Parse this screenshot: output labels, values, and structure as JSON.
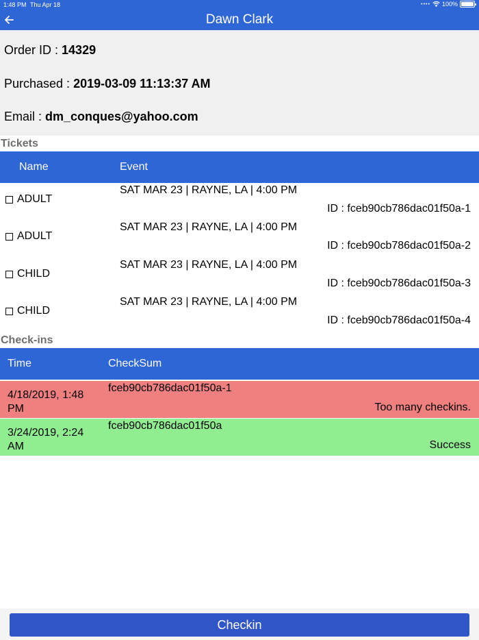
{
  "status_bar": {
    "time": "1:48 PM",
    "date": "Thu Apr 18",
    "battery": "100%"
  },
  "header": {
    "back_icon": "arrow-left-icon",
    "title": "Dawn Clark"
  },
  "order": {
    "order_id_label": "Order ID :",
    "order_id": "14329",
    "purchased_label": "Purchased :",
    "purchased": "2019-03-09 11:13:37 AM",
    "email_label": "Email :",
    "email": "dm_conques@yahoo.com"
  },
  "tickets": {
    "section_title": "Tickets",
    "columns": [
      "Name",
      "Event"
    ],
    "rows": [
      {
        "name": "ADULT",
        "event": "SAT MAR 23 | RAYNE, LA | 4:00 PM",
        "id": "ID : fceb90cb786dac01f50a-1"
      },
      {
        "name": "ADULT",
        "event": "SAT MAR 23 | RAYNE, LA | 4:00 PM",
        "id": "ID : fceb90cb786dac01f50a-2"
      },
      {
        "name": "CHILD",
        "event": "SAT MAR 23 | RAYNE, LA | 4:00 PM",
        "id": "ID : fceb90cb786dac01f50a-3"
      },
      {
        "name": "CHILD",
        "event": "SAT MAR 23 | RAYNE, LA | 4:00 PM",
        "id": "ID : fceb90cb786dac01f50a-4"
      }
    ]
  },
  "checkins": {
    "section_title": "Check-ins",
    "columns": [
      "Time",
      "CheckSum"
    ],
    "rows": [
      {
        "time": "4/18/2019, 1:48 PM",
        "checksum": "fceb90cb786dac01f50a-1",
        "status": "Too many checkins.",
        "color": "#f08080"
      },
      {
        "time": "3/24/2019, 2:24 AM",
        "checksum": "fceb90cb786dac01f50a",
        "status": "Success",
        "color": "#90ee90"
      }
    ]
  },
  "footer": {
    "checkin_label": "Checkin"
  },
  "colors": {
    "primary": "#2f66d6",
    "button": "#2f55c6",
    "error_row": "#f08080",
    "success_row": "#90ee90"
  }
}
